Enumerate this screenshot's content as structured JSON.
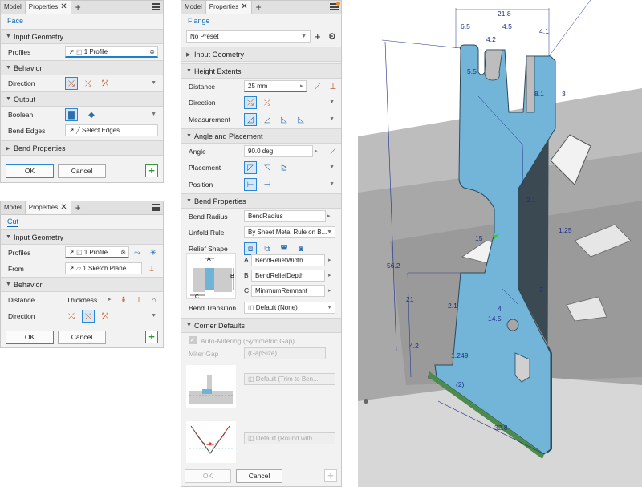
{
  "face_panel": {
    "tabs": [
      "Model",
      "Properties"
    ],
    "title": "Face",
    "input_geometry": "Input Geometry",
    "profiles_label": "Profiles",
    "profiles_value": "1 Profile",
    "behavior": "Behavior",
    "direction_label": "Direction",
    "output": "Output",
    "boolean_label": "Boolean",
    "bend_edges_label": "Bend Edges",
    "bend_edges_value": "Select Edges",
    "bend_properties": "Bend Properties",
    "ok": "OK",
    "cancel": "Cancel"
  },
  "cut_panel": {
    "tabs": [
      "Model",
      "Properties"
    ],
    "title": "Cut",
    "input_geometry": "Input Geometry",
    "profiles_label": "Profiles",
    "profiles_value": "1 Profile",
    "from_label": "From",
    "from_value": "1 Sketch Plane",
    "behavior": "Behavior",
    "distance_label": "Distance",
    "distance_value": "Thickness",
    "direction_label": "Direction",
    "ok": "OK",
    "cancel": "Cancel"
  },
  "flange_panel": {
    "tabs": [
      "Model",
      "Properties"
    ],
    "title": "Flange",
    "preset": "No Preset",
    "input_geometry": "Input Geometry",
    "height_extents": "Height Extents",
    "distance_label": "Distance",
    "distance_value": "25 mm",
    "direction_label": "Direction",
    "measurement_label": "Measurement",
    "angle_placement": "Angle and Placement",
    "angle_label": "Angle",
    "angle_value": "90.0 deg",
    "placement_label": "Placement",
    "position_label": "Position",
    "bend_properties": "Bend Properties",
    "bend_radius_label": "Bend Radius",
    "bend_radius_value": "BendRadius",
    "unfold_rule_label": "Unfold Rule",
    "unfold_rule_value": "By Sheet Metal Rule on B...",
    "relief_shape_label": "Relief Shape",
    "relief": [
      {
        "key": "A",
        "value": "BendReliefWidth"
      },
      {
        "key": "B",
        "value": "BendReliefDepth"
      },
      {
        "key": "C",
        "value": "MinimumRemnant"
      }
    ],
    "diagram_labels": {
      "a": "A",
      "b": "B",
      "c": "C"
    },
    "bend_transition_label": "Bend Transition",
    "bend_transition_value": "Default (None)",
    "corner_defaults": "Corner Defaults",
    "auto_mitering": "Auto-Mitering (Symmetric Gap)",
    "miter_gap_label": "Miter Gap",
    "miter_gap_value": "(GapSize)",
    "corner_relief_value": "Default (Trim to Ben...",
    "corner_round_value": "Default (Round with...",
    "ok": "OK",
    "cancel": "Cancel"
  },
  "cad_dims": [
    "21.8",
    "6.5",
    "4.2",
    "4.5",
    "4.1",
    "5.5",
    "8.1",
    "3",
    "2.1",
    "1.25",
    "15",
    "56.2",
    "21",
    "3",
    "2.1",
    "4",
    "14.5",
    "4.2",
    "1.2",
    "49",
    "(2)",
    "32.8"
  ],
  "colors": {
    "accent": "#1a7fd0",
    "part": "#6fb3d6",
    "dim": "#1d2d8a",
    "ok_border": "#2a86d6",
    "plus_green": "#2a9a2a",
    "notification_dot": "#f08a24"
  }
}
